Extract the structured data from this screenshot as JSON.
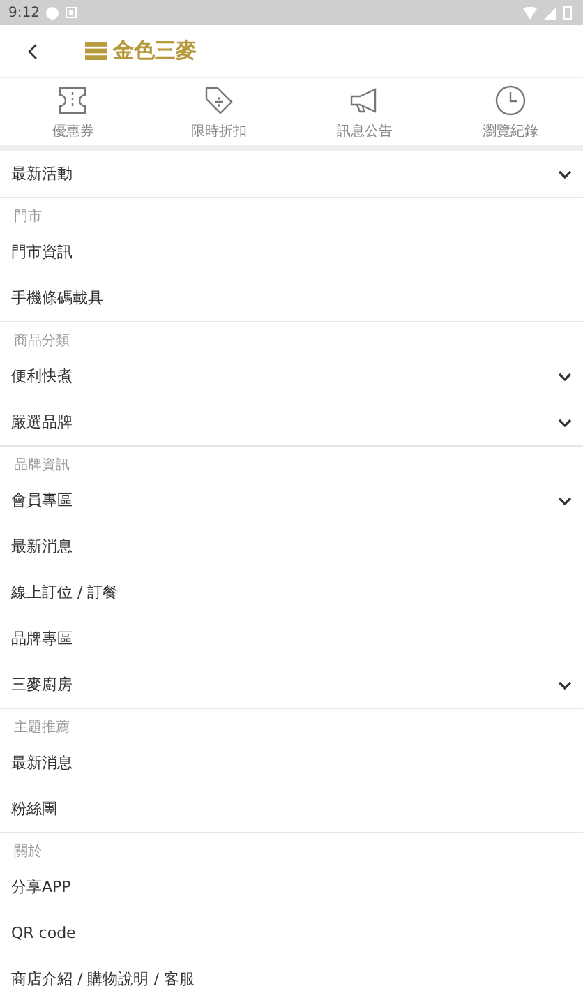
{
  "status_bar": {
    "time": "9:12"
  },
  "header": {
    "brand": "金色三麥"
  },
  "shortcuts": [
    {
      "kind": "ticket",
      "label": "優惠券"
    },
    {
      "kind": "tag",
      "label": "限時折扣"
    },
    {
      "kind": "megaphone",
      "label": "訊息公告"
    },
    {
      "kind": "clock",
      "label": "瀏覽紀錄"
    }
  ],
  "sections": [
    {
      "items": [
        {
          "label": "最新活動",
          "has_submenu": true
        }
      ]
    },
    {
      "title": "門市",
      "items": [
        {
          "label": "門市資訊",
          "has_submenu": false
        },
        {
          "label": "手機條碼載具",
          "has_submenu": false
        }
      ]
    },
    {
      "title": "商品分類",
      "items": [
        {
          "label": "便利快煮",
          "has_submenu": true
        },
        {
          "label": "嚴選品牌",
          "has_submenu": true
        }
      ]
    },
    {
      "title": "品牌資訊",
      "items": [
        {
          "label": "會員專區",
          "has_submenu": true
        },
        {
          "label": "最新消息",
          "has_submenu": false
        },
        {
          "label": "線上訂位 / 訂餐",
          "has_submenu": false
        },
        {
          "label": "品牌專區",
          "has_submenu": false
        },
        {
          "label": "三麥廚房",
          "has_submenu": true
        }
      ]
    },
    {
      "title": "主題推薦",
      "items": [
        {
          "label": "最新消息",
          "has_submenu": false
        },
        {
          "label": "粉絲團",
          "has_submenu": false
        }
      ]
    },
    {
      "title": "關於",
      "items": [
        {
          "label": "分享APP",
          "has_submenu": false
        },
        {
          "label": "QR code",
          "has_submenu": false
        },
        {
          "label": "商店介紹 / 購物說明 / 客服",
          "has_submenu": false
        }
      ]
    }
  ]
}
